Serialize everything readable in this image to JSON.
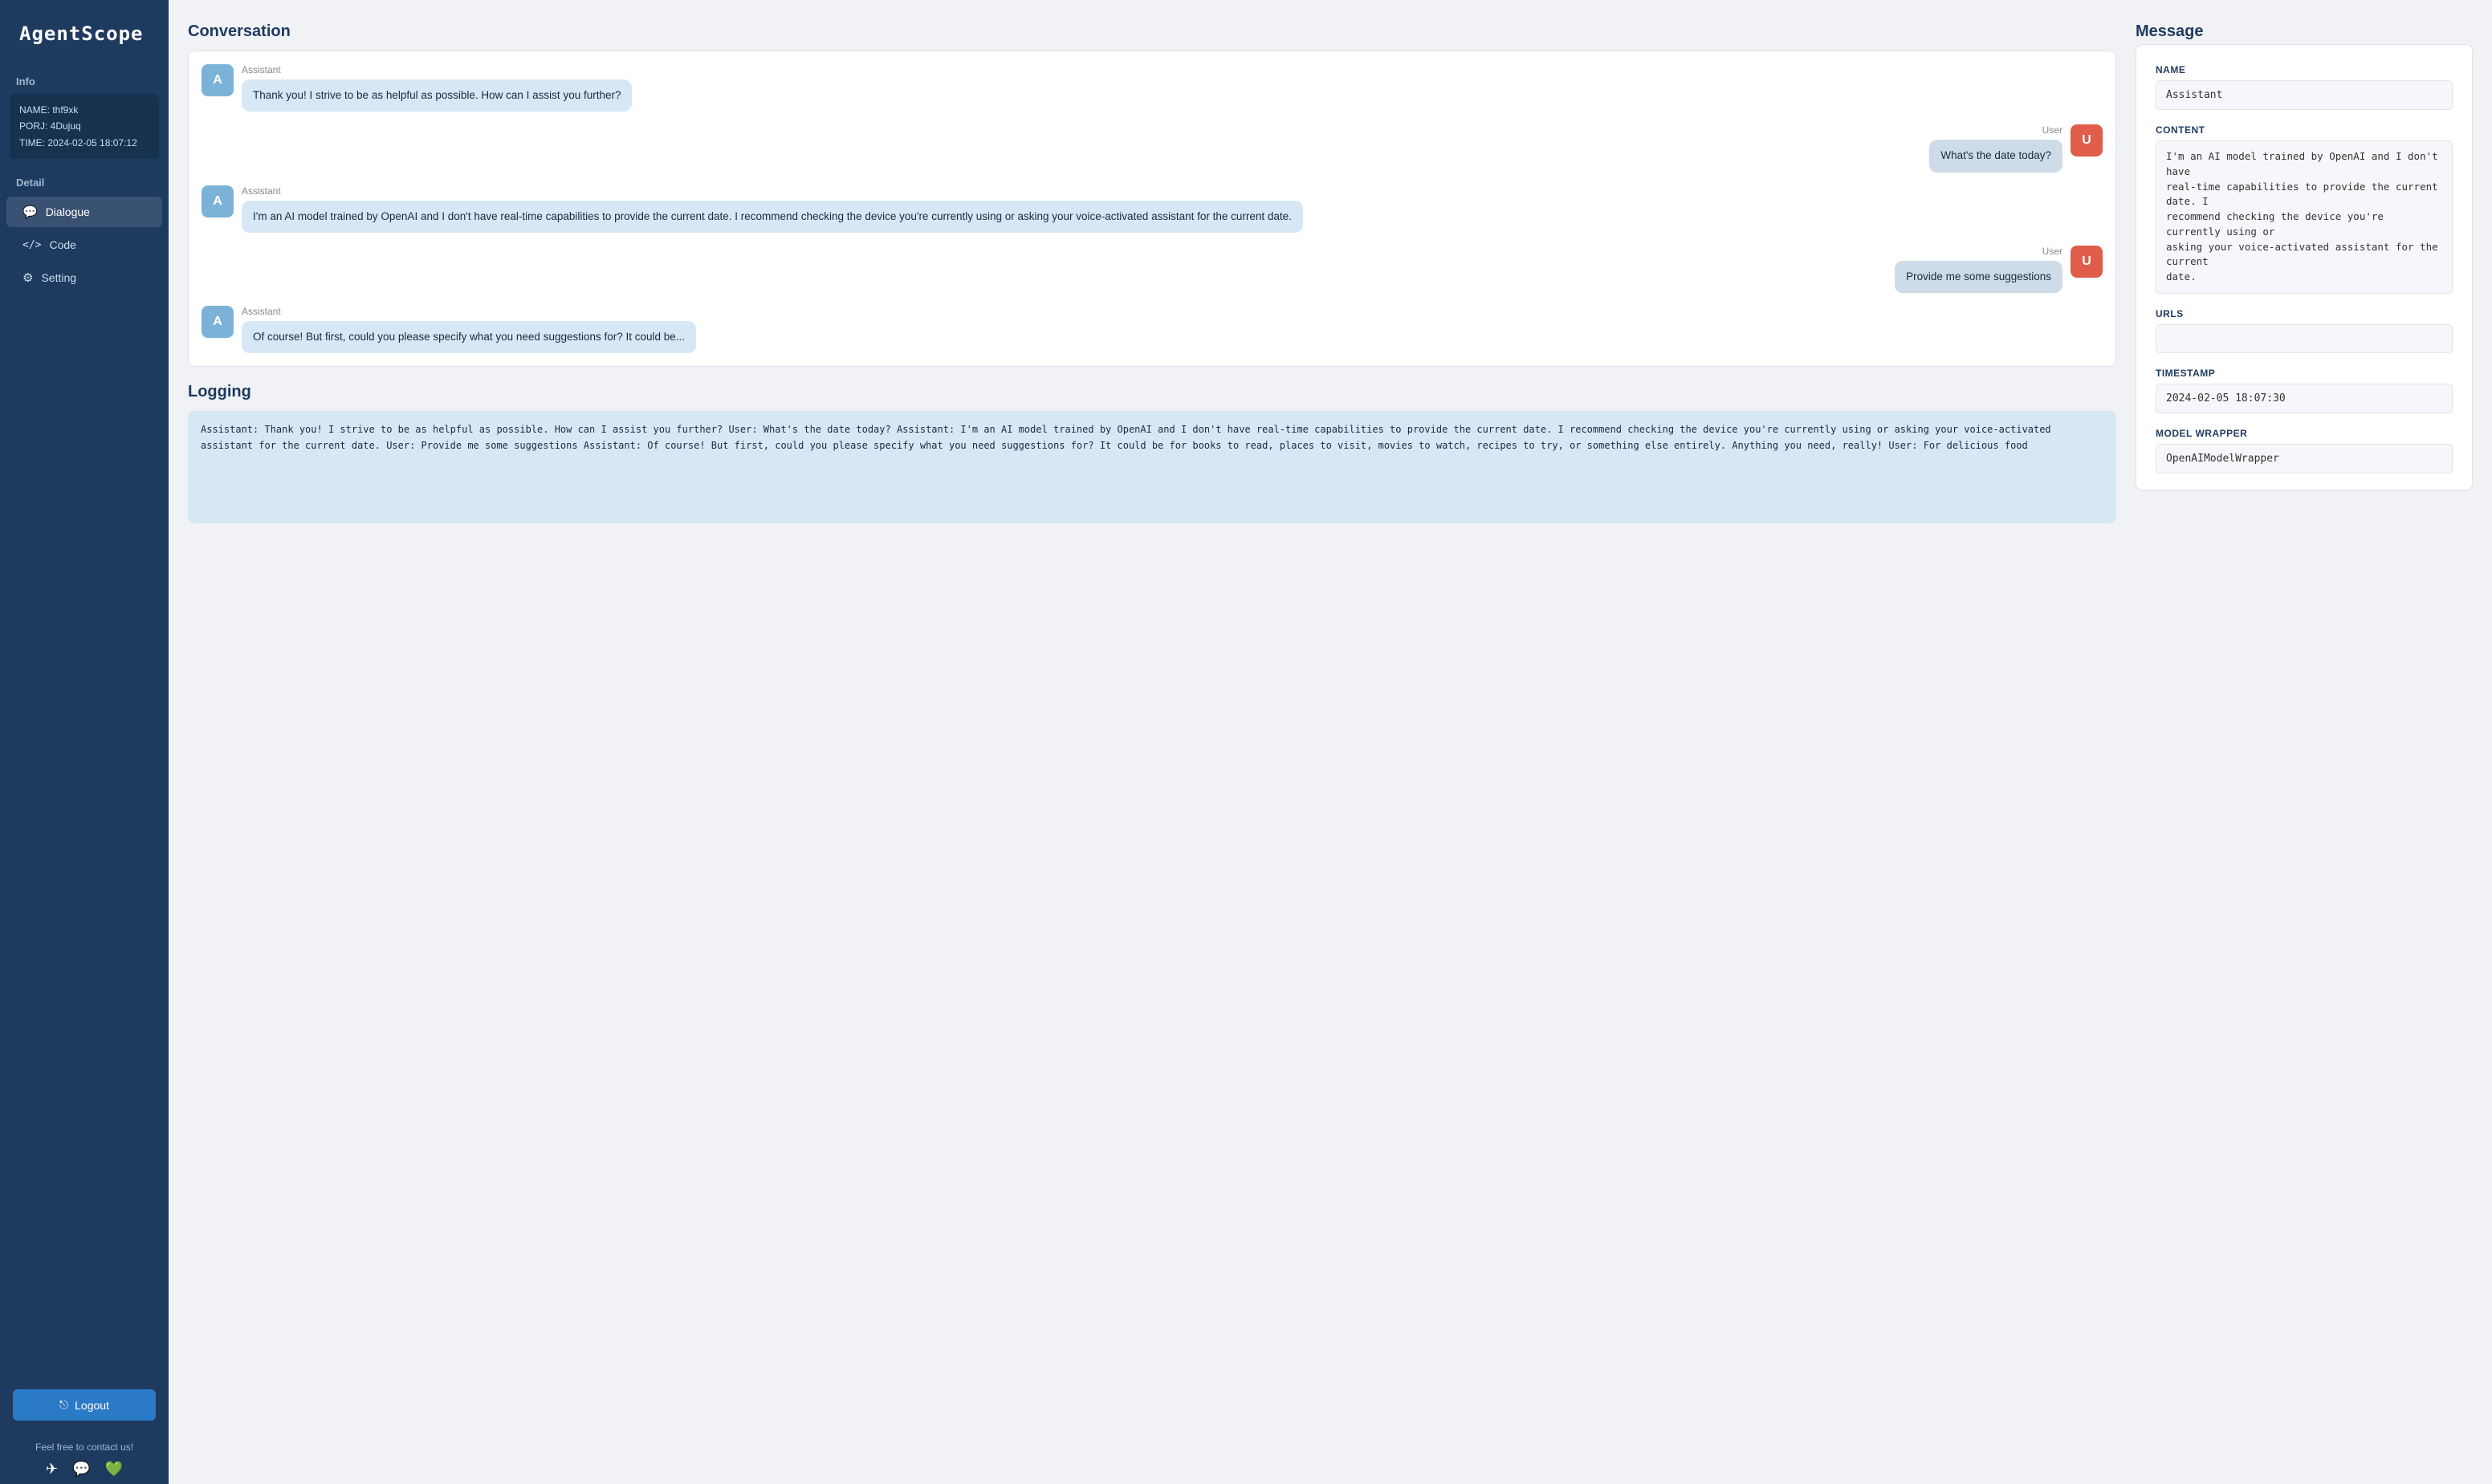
{
  "sidebar": {
    "logo": "AgentScope",
    "info_label": "Info",
    "info": {
      "name": "NAME: thf9xk",
      "proj": "PORJ: 4Dujuq",
      "time": "TIME: 2024-02-05 18:07:12"
    },
    "detail_label": "Detail",
    "nav_items": [
      {
        "id": "dialogue",
        "label": "Dialogue",
        "icon": "💬",
        "active": true
      },
      {
        "id": "code",
        "label": "Code",
        "icon": "</>",
        "active": false
      },
      {
        "id": "setting",
        "label": "Setting",
        "icon": "⚙",
        "active": false
      }
    ],
    "logout_label": "Logout",
    "logout_icon": "⎋",
    "contact_text": "Feel free to contact us!",
    "contact_icons": [
      "✈",
      "💬",
      "💚"
    ]
  },
  "conversation": {
    "title": "Conversation",
    "messages": [
      {
        "role": "assistant",
        "sender": "Assistant",
        "avatar": "A",
        "text": "Thank you! I strive to be as helpful as possible. How can I assist you further?"
      },
      {
        "role": "user",
        "sender": "User",
        "avatar": "U",
        "text": "What's the date today?"
      },
      {
        "role": "assistant",
        "sender": "Assistant",
        "avatar": "A",
        "text": "I'm an AI model trained by OpenAI and I don't have real-time capabilities to provide the current date. I recommend checking the device you're currently using or asking your voice-activated assistant for the current date."
      },
      {
        "role": "user",
        "sender": "User",
        "avatar": "U",
        "text": "Provide me some suggestions"
      },
      {
        "role": "assistant",
        "sender": "Assistant",
        "avatar": "A",
        "text": "Of course! But first, could you please specify what you need suggestions for? It could be..."
      }
    ]
  },
  "logging": {
    "title": "Logging",
    "text": "Assistant: Thank you! I strive to be as helpful as possible. How can I assist you\nfurther?\nUser: What's the date today?\nAssistant: I'm an AI model trained by OpenAI and I don't have real-time capabilities to\nprovide the current date. I recommend checking the device you're currently using or\nasking your voice-activated assistant for the current date.\nUser: Provide me some suggestions\nAssistant: Of course! But first, could you please specify what you need suggestions\nfor? It could be for books to read, places to visit, movies to watch, recipes to try,\nor something else entirely. Anything you need, really!\nUser: For delicious food"
  },
  "message": {
    "title": "Message",
    "name_label": "NAME",
    "name_value": "Assistant",
    "content_label": "CONTENT",
    "content_value": "I'm an AI model trained by OpenAI and I don't have\nreal-time capabilities to provide the current date. I\nrecommend checking the device you're currently using or\nasking your voice-activated assistant for the current\ndate.",
    "urls_label": "URLS",
    "urls_value": "",
    "timestamp_label": "TIMESTAMP",
    "timestamp_value": "2024-02-05 18:07:30",
    "model_wrapper_label": "MODEL WRAPPER",
    "model_wrapper_value": "OpenAIModelWrapper"
  }
}
